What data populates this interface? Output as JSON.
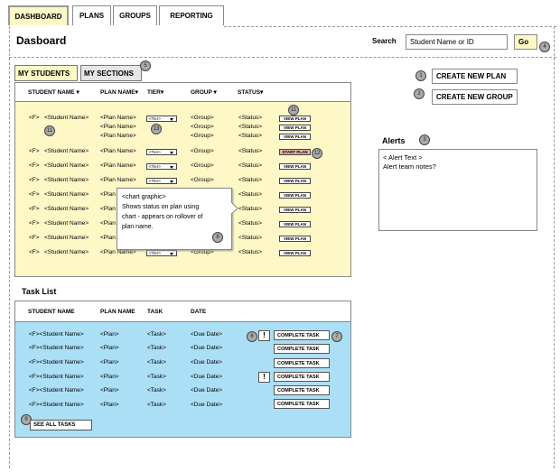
{
  "tabs": [
    {
      "label": "DASHBOARD",
      "active": true
    },
    {
      "label": "PLANS"
    },
    {
      "label": "GROUPS"
    },
    {
      "label": "REPORTING"
    }
  ],
  "page_title": "Dasboard",
  "search": {
    "label": "Search",
    "value": "Student Name or ID",
    "go": "Go",
    "badge": "4"
  },
  "student_tabs": {
    "my_students": "MY STUDENTS",
    "my_sections": "MY SECTIONS",
    "badge": "5"
  },
  "students_headers": [
    "STUDENT NAME",
    "PLAN NAME",
    "TIER",
    "GROUP",
    "STATUS"
  ],
  "students": [
    {
      "prefix": "<F>",
      "name": "<Student Name>",
      "plans": [
        {
          "plan": "<Plan Name>",
          "tier": "<Tier>",
          "group": "<Group>",
          "status": "<Status>",
          "action": "VIEW PLAN"
        },
        {
          "plan": "<Plan Name>",
          "tier": "",
          "group": "<Group>",
          "status": "<Status>",
          "action": "VIEW PLAN"
        },
        {
          "plan": "<Plan Name>",
          "tier": "",
          "group": "<Group>",
          "status": "<Status>",
          "action": "VIEW PLAN"
        }
      ]
    },
    {
      "prefix": "<F>",
      "name": "<Student Name>",
      "plans": [
        {
          "plan": "<Plan Name>",
          "tier": "<Tier>",
          "group": "<Group>",
          "status": "<Status>",
          "action": "START PLAN"
        }
      ]
    },
    {
      "prefix": "<F>",
      "name": "<Student Name>",
      "plans": [
        {
          "plan": "<Plan Name>",
          "tier": "<Tier>",
          "group": "<Group>",
          "status": "<Status>",
          "action": "VIEW PLAN"
        }
      ]
    },
    {
      "prefix": "<F>",
      "name": "<Student Name>",
      "plans": [
        {
          "plan": "<Plan Name>",
          "tier": "<Tier>",
          "group": "<Group>",
          "status": "<Status>",
          "action": "VIEW PLAN"
        }
      ]
    },
    {
      "prefix": "<F>",
      "name": "<Student Name>",
      "plans": [
        {
          "plan": "<Plan",
          "tier": "",
          "group": "",
          "status": "<Status>",
          "action": "VIEW PLAN"
        }
      ]
    },
    {
      "prefix": "<F>",
      "name": "<Student Name>",
      "plans": [
        {
          "plan": "<Plan",
          "tier": "",
          "group": "",
          "status": "<Status>",
          "action": "VIEW PLAN"
        }
      ]
    },
    {
      "prefix": "<F>",
      "name": "<Student Name>",
      "plans": [
        {
          "plan": "<Plan",
          "tier": "",
          "group": "",
          "status": "<Status>",
          "action": "VIEW PLAN"
        }
      ]
    },
    {
      "prefix": "<F>",
      "name": "<Student Name>",
      "plans": [
        {
          "plan": "<Plan",
          "tier": "",
          "group": "",
          "status": "<Status>",
          "action": "VIEW PLAN"
        }
      ]
    },
    {
      "prefix": "<F>",
      "name": "<Student Name>",
      "plans": [
        {
          "plan": "<Plan Name>",
          "tier": "<Tier>",
          "group": "<Group>",
          "status": "<Status>",
          "action": "VIEW PLAN"
        }
      ]
    }
  ],
  "student_badges": {
    "first_row_name": "11",
    "first_row_tier": "13",
    "view_plan": "11",
    "start_plan": "12"
  },
  "tooltip": {
    "title": "<chart graphic>",
    "lines": [
      "Shows status on plan using",
      "chart - appears on rollover of",
      "plan name."
    ],
    "badge": "8"
  },
  "task_list": {
    "title": "Task List",
    "headers": [
      "STUDENT NAME",
      "PLAN NAME",
      "TASK",
      "DATE"
    ],
    "rows": [
      {
        "name": "<F><Student Name>",
        "plan": "<Plan>",
        "task": "<Task>",
        "date": "<Due Date>",
        "flag": "!",
        "action": "COMPLETE TASK"
      },
      {
        "name": "<F><Student Name>",
        "plan": "<Plan>",
        "task": "<Task>",
        "date": "<Due Date>",
        "flag": "",
        "action": "COMPLETE TASK"
      },
      {
        "name": "<F><Student Name>",
        "plan": "<Plan>",
        "task": "<Task>",
        "date": "<Due Date>",
        "flag": "",
        "action": "COMPLETE TASK"
      },
      {
        "name": "<F><Student Name>",
        "plan": "<Plan>",
        "task": "<Task>",
        "date": "<Due Date>",
        "flag": "!",
        "action": "COMPLETE TASK"
      },
      {
        "name": "<F><Student Name>",
        "plan": "<Plan>",
        "task": "<Task>",
        "date": "<Due Date>",
        "flag": "",
        "action": "COMPLETE TASK"
      },
      {
        "name": "<F><Student Name>",
        "plan": "<Plan>",
        "task": "<Task>",
        "date": "<Due Date>",
        "flag": "",
        "action": "COMPLETE TASK"
      }
    ],
    "see_all": "SEE ALL TASKS",
    "flag_badge": "6",
    "complete_badge": "7",
    "see_all_badge": "9"
  },
  "actions": {
    "create_plan": "CREATE NEW PLAN",
    "create_group": "CREATE NEW GROUP",
    "create_plan_badge": "1",
    "create_group_badge": "2"
  },
  "alerts": {
    "title": "Alerts",
    "badge": "3",
    "lines": [
      "< Alert Text >",
      "Alert team notes?"
    ]
  },
  "colors": {
    "yellow_panel": "#fdf8c6",
    "blue_panel": "#abdff5",
    "start_plan": "#e0b6a8",
    "badge": "#aaaaaa"
  }
}
